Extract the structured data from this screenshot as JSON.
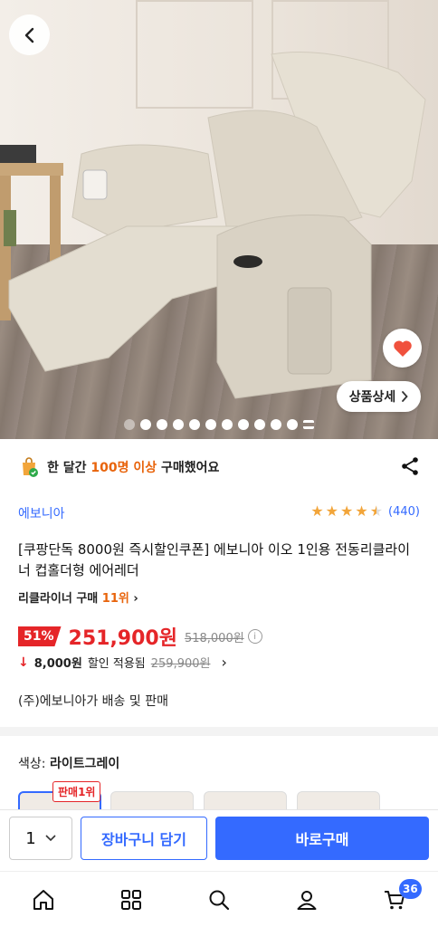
{
  "hero": {
    "detail_label": "상품상세",
    "gallery_dots": 11
  },
  "social_proof": {
    "prefix": "한 달간 ",
    "highlight": "100명 이상",
    "suffix": " 구매했어요"
  },
  "product": {
    "brand": "에보니아",
    "rating_value": 4.5,
    "review_count": "(440)",
    "title": "[쿠팡단독 8000원 즉시할인쿠폰] 에보니아 이오 1인용 전동리클라이너 컵홀더형 에어레더",
    "rank_label": "리클라이너 구매 ",
    "rank_value": "11위",
    "discount_pct": "51%",
    "price": "251,900원",
    "original_price": "518,000원",
    "coupon_amount": "8,000원",
    "coupon_text": "할인 적용됨",
    "coupon_was": "259,900원",
    "seller": "(주)에보니아가 배송 및 판매"
  },
  "options": {
    "color_label": "색상: ",
    "color_value": "라이트그레이",
    "best_badge": "판매1위"
  },
  "purchase_bar": {
    "quantity": "1",
    "cart_label": "장바구니 담기",
    "buy_label": "바로구매"
  },
  "bottom_nav": {
    "cart_count": "36"
  },
  "colors": {
    "accent": "#346aff",
    "price_red": "#e52528",
    "highlight_orange": "#e8640c"
  }
}
